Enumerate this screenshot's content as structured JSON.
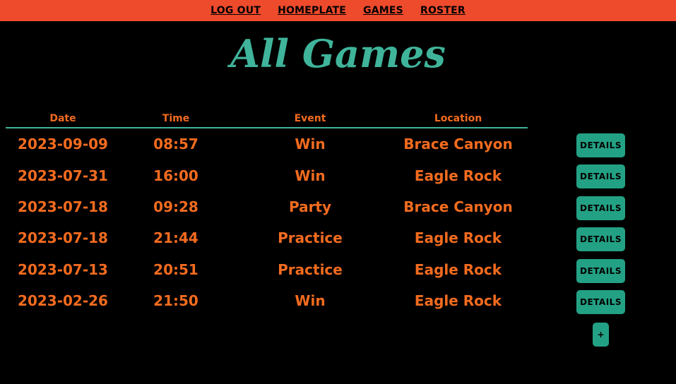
{
  "nav": {
    "logout": "LOG OUT",
    "homeplate": "HOMEPLATE",
    "games": "GAMES",
    "roster": "ROSTER"
  },
  "page": {
    "title": "All Games"
  },
  "table": {
    "headers": {
      "date": "Date",
      "time": "Time",
      "event": "Event",
      "location": "Location"
    },
    "rows": [
      {
        "date": "2023-09-09",
        "time": "08:57",
        "event": "Win",
        "location": "Brace Canyon",
        "action": "DETAILS"
      },
      {
        "date": "2023-07-31",
        "time": "16:00",
        "event": "Win",
        "location": "Eagle Rock",
        "action": "DETAILS"
      },
      {
        "date": "2023-07-18",
        "time": "09:28",
        "event": "Party",
        "location": "Brace Canyon",
        "action": "DETAILS"
      },
      {
        "date": "2023-07-18",
        "time": "21:44",
        "event": "Practice",
        "location": "Eagle Rock",
        "action": "DETAILS"
      },
      {
        "date": "2023-07-13",
        "time": "20:51",
        "event": "Practice",
        "location": "Eagle Rock",
        "action": "DETAILS"
      },
      {
        "date": "2023-02-26",
        "time": "21:50",
        "event": "Win",
        "location": "Eagle Rock",
        "action": "DETAILS"
      }
    ]
  },
  "add_button": {
    "label": "+"
  },
  "colors": {
    "nav_bg": "#ee4a2c",
    "title": "#3fb49a",
    "text": "#f26b1f",
    "button": "#23a184",
    "background": "#000000"
  }
}
